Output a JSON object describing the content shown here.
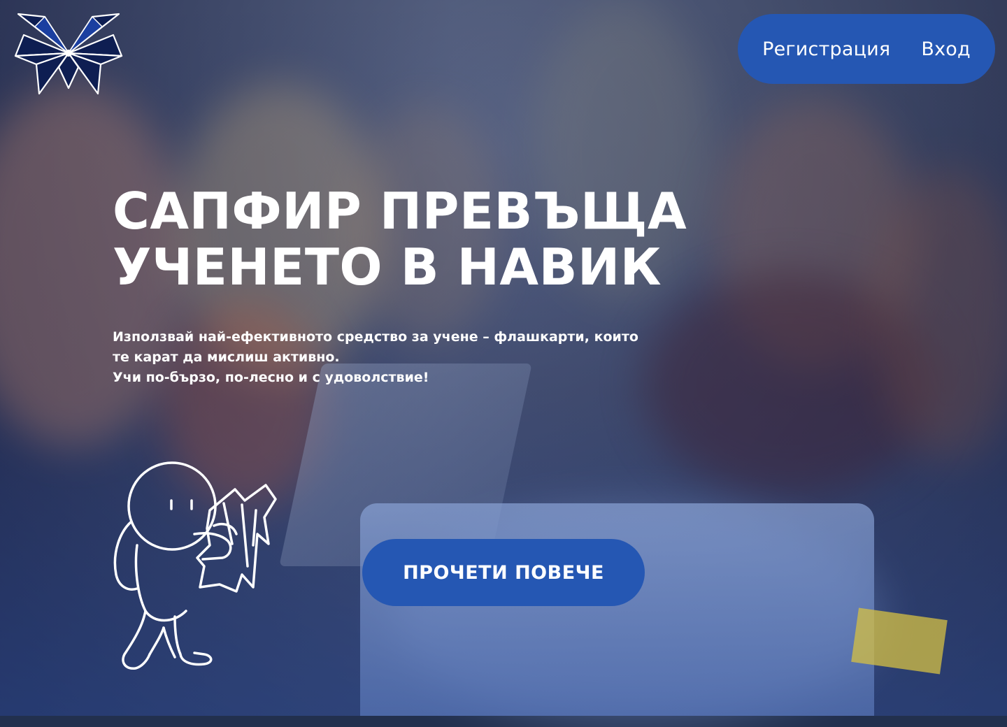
{
  "nav": {
    "register_label": "Регистрация",
    "login_label": "Вход"
  },
  "hero": {
    "headline_line1": "САПФИР ПРЕВЪЩА",
    "headline_line2": "УЧЕНЕТО В НАВИК",
    "subtitle_line1": "Използвай най-ефективното средство за учене – флашкарти, които",
    "subtitle_line2": "те карат да мислиш активно.",
    "subtitle_line3": "Учи по-бързо, по-лесно и с удоволствие!",
    "cta_label": "ПРОЧЕТИ ПОВЕЧЕ"
  },
  "colors": {
    "accent": "#2557b3",
    "overlay": "#1c2a5e",
    "text": "#ffffff"
  },
  "icons": {
    "logo": "sapphire-butterfly-logo",
    "mascot": "astronaut-reading-map-illustration"
  }
}
